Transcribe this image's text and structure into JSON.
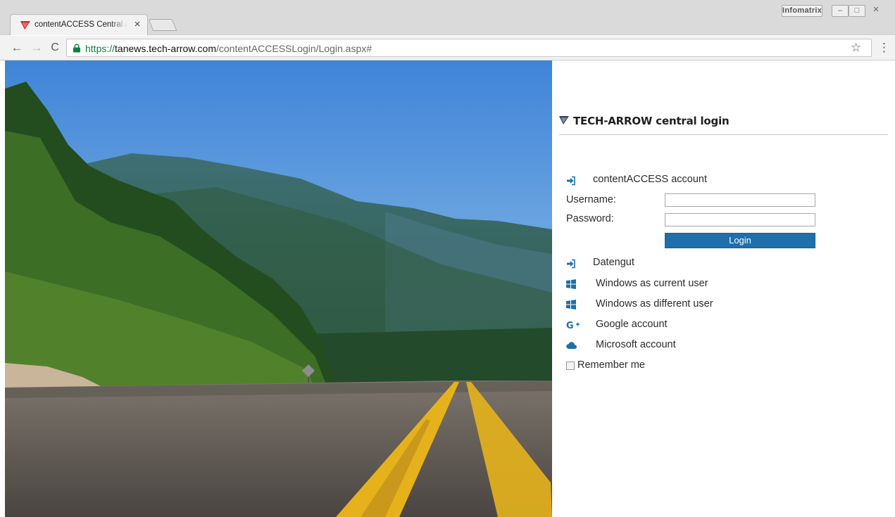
{
  "browser": {
    "tab_title": "contentACCESS Central Administration",
    "tab_close": "×",
    "url_protocol": "https://",
    "url_host": "tanews.tech-arrow.com",
    "url_path": "/contentACCESSLogin/Login.aspx#",
    "profile_name": "Infomatrix",
    "win_minimize": "–",
    "win_maximize": "□",
    "win_close": "✕",
    "back_icon": "←",
    "forward_icon": "→",
    "reload_icon": "C",
    "star_icon": "☆",
    "menu_icon": "⋮"
  },
  "login": {
    "title": "TECH-ARROW central login",
    "account_label": "contentACCESS account",
    "username_label": "Username:",
    "password_label": "Password:",
    "username_value": "",
    "password_value": "",
    "login_button": "Login",
    "providers": {
      "datengut": "Datengut",
      "windows_current": "Windows as current user",
      "windows_different": "Windows as different user",
      "google": "Google account",
      "microsoft": "Microsoft account"
    },
    "remember_label": "Remember me",
    "remember_checked": false
  },
  "colors": {
    "brand_red": "#d8232a",
    "brand_dark": "#2b4160",
    "button_blue": "#1e6fac",
    "icon_blue": "#1e6fac"
  },
  "icons": {
    "tab": "tech-arrow-logo-icon",
    "account": "sign-in-icon",
    "datengut": "sign-in-icon",
    "windows": "windows-icon",
    "google": "google-plus-icon",
    "microsoft": "cloud-icon"
  }
}
